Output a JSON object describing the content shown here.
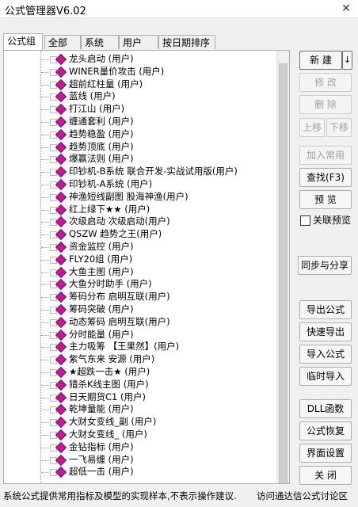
{
  "window": {
    "title": "公式管理器V6.02",
    "close_glyph": "✕"
  },
  "tabs": [
    "公式组",
    "全部",
    "系统",
    "用户",
    "按日期排序"
  ],
  "tree_items": [
    "龙头启动  (用户)",
    "WINER量价攻击  (用户)",
    "超前红柱量  (用户)",
    "蓝线  (用户)",
    "打江山  (用户)",
    "缠通套利  (用户)",
    "趋势稳盈  (用户)",
    "趋势顶底  (用户)",
    "爆赢法则  (用户)",
    "印钞机-B系统  联合开发-实战试用版(用户)",
    "印钞机-A系统  (用户)",
    "神渔短线副图  股海神渔(用户)",
    "红上绿下★★  (用户)",
    "次级启动  次级启动(用户)",
    "QSZW  趋势之王(用户)",
    "资金监控  (用户)",
    "FLY20组  (用户)",
    "大鱼主图  (用户)",
    "大鱼分时助手  (用户)",
    "筹码分布  启明互联(用户)",
    "筹码突破  (用户)",
    "动态筹码  启明互联(用户)",
    "分时能量  (用户)",
    "主力吸筹  【王果然】(用户)",
    "紫气东来 安源  (用户)",
    "★超跌一击★  (用户)",
    "猎杀K线主图  (用户)",
    "日天期货C1  (用户)",
    "乾坤量能  (用户)",
    "大财女变线_副  (用户)",
    "大财女变线_  (用户)",
    "金钻指标  (用户)",
    "一飞易缠  (用户)",
    "超低一击  (用户)"
  ],
  "buttons": {
    "new": "新 建",
    "new_arrow": "↓",
    "edit": "修 改",
    "delete": "删 除",
    "move_up": "上移",
    "move_down": "下移",
    "add_common": "加入常用",
    "find": "查找(F3)",
    "preview": "预 览",
    "linked_preview": "关联预览",
    "sync_share": "同步与分享",
    "export": "导出公式",
    "quick_export": "快速导出",
    "import": "导入公式",
    "temp_import": "临时导入",
    "dll": "DLL函数",
    "restore": "公式恢复",
    "interface": "界面设置",
    "close": "关 闭"
  },
  "status": {
    "message": "系统公式提供常用指标及模型的实现样本,不表示操作建议.",
    "link": "访问通达信公式讨论区"
  }
}
